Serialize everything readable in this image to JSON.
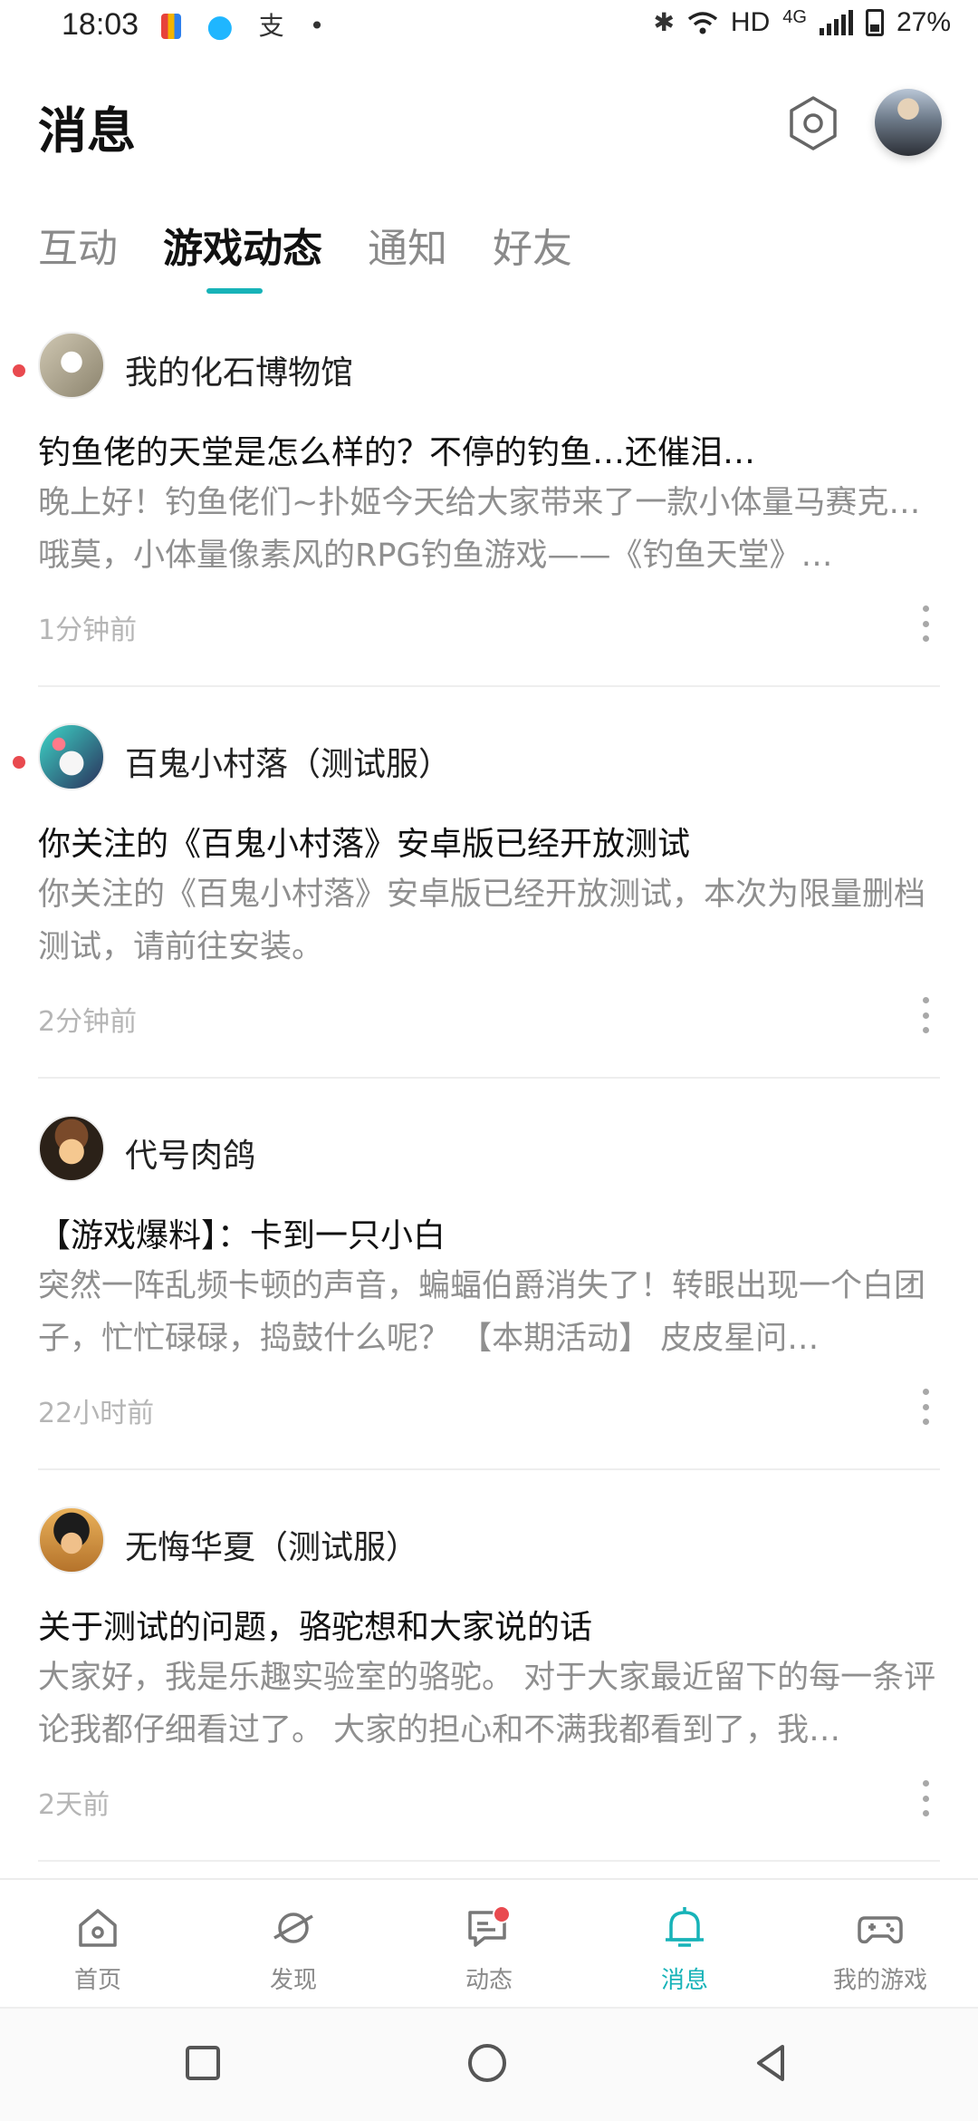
{
  "status_bar": {
    "time": "18:03",
    "network_label": "HD",
    "network_type": "4G",
    "battery_percent": "27%"
  },
  "header": {
    "title": "消息"
  },
  "tabs": [
    {
      "label": "互动",
      "active": false
    },
    {
      "label": "游戏动态",
      "active": true
    },
    {
      "label": "通知",
      "active": false
    },
    {
      "label": "好友",
      "active": false
    }
  ],
  "feed": [
    {
      "game_name": "我的化石博物馆",
      "unread": true,
      "title": "钓鱼佬的天堂是怎么样的？不停的钓鱼…还催泪…",
      "body": "晚上好！钓鱼佬们~扑姬今天给大家带来了一款小体量马赛克…哦莫，小体量像素风的RPG钓鱼游戏——《钓鱼天堂》…",
      "time": "1分钟前"
    },
    {
      "game_name": "百鬼小村落（测试服）",
      "unread": true,
      "title": "你关注的《百鬼小村落》安卓版已经开放测试",
      "body": "你关注的《百鬼小村落》安卓版已经开放测试，本次为限量删档测试，请前往安装。",
      "time": "2分钟前"
    },
    {
      "game_name": "代号肉鸽",
      "unread": false,
      "title": "【游戏爆料】：卡到一只小白",
      "body": "突然一阵乱频卡顿的声音，蝙蝠伯爵消失了！转眼出现一个白团子，忙忙碌碌，捣鼓什么呢？ 【本期活动】 皮皮星问…",
      "time": "22小时前"
    },
    {
      "game_name": "无悔华夏（测试服）",
      "unread": false,
      "title": "关于测试的问题，骆驼想和大家说的话",
      "body": "大家好，我是乐趣实验室的骆驼。 对于大家最近留下的每一条评论我都仔细看过了。 大家的担心和不满我都看到了，我…",
      "time": "2天前"
    }
  ],
  "bottom_nav": [
    {
      "label": "首页",
      "icon": "home-icon",
      "active": false
    },
    {
      "label": "发现",
      "icon": "planet-icon",
      "active": false
    },
    {
      "label": "动态",
      "icon": "chat-icon",
      "active": false,
      "badge": true
    },
    {
      "label": "消息",
      "icon": "bell-icon",
      "active": true
    },
    {
      "label": "我的游戏",
      "icon": "gamepad-icon",
      "active": false
    }
  ],
  "colors": {
    "accent": "#17b3b8",
    "unread": "#e94a4f"
  }
}
